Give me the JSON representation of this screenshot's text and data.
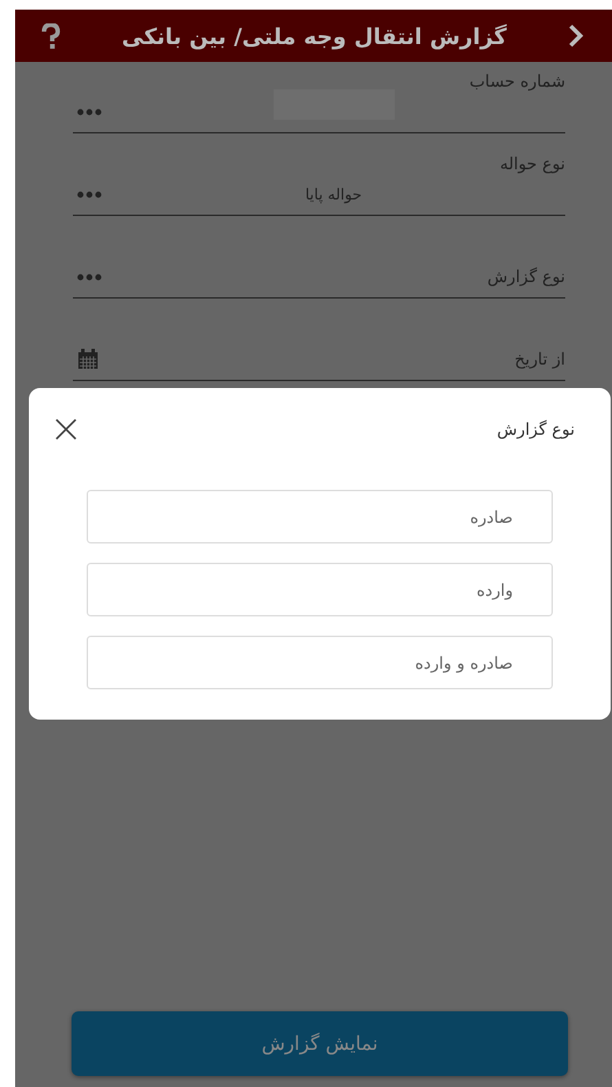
{
  "header": {
    "title": "گزارش انتقال وجه ملتی/ بین بانکی"
  },
  "fields": [
    {
      "kind": "picker",
      "label": "شماره حساب",
      "redacted": true
    },
    {
      "kind": "picker",
      "label": "نوع حواله",
      "value": "حواله پایا"
    },
    {
      "kind": "picker",
      "label": "نوع گزارش"
    },
    {
      "kind": "date",
      "label": "از تاریخ"
    }
  ],
  "dialog": {
    "title": "نوع گزارش",
    "options": [
      {
        "label": "صادره"
      },
      {
        "label": "وارده"
      },
      {
        "label": "صادره و وارده"
      }
    ]
  },
  "submit_button": {
    "label": "نمایش گزارش"
  }
}
